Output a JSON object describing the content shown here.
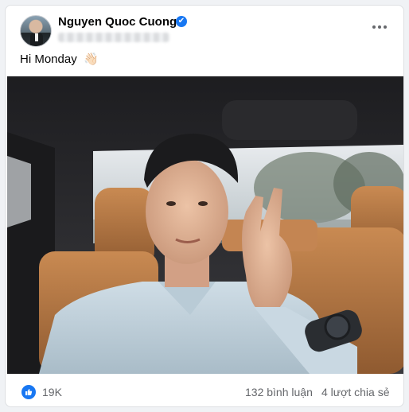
{
  "post": {
    "author_name": "Nguyen Quoc Cuong",
    "caption": "Hi Monday",
    "caption_emoji": "👋🏻",
    "verified_mark": "✔"
  },
  "stats": {
    "reactions": "19K",
    "comments": "132 bình luận",
    "shares": "4 lượt chia sẻ"
  },
  "icons": {
    "verified": "verified-badge-icon",
    "more": "more-options-icon",
    "like": "like-reaction-icon"
  },
  "colors": {
    "brand_blue": "#1877f2",
    "secondary_text": "#65676b",
    "primary_text": "#050505"
  }
}
